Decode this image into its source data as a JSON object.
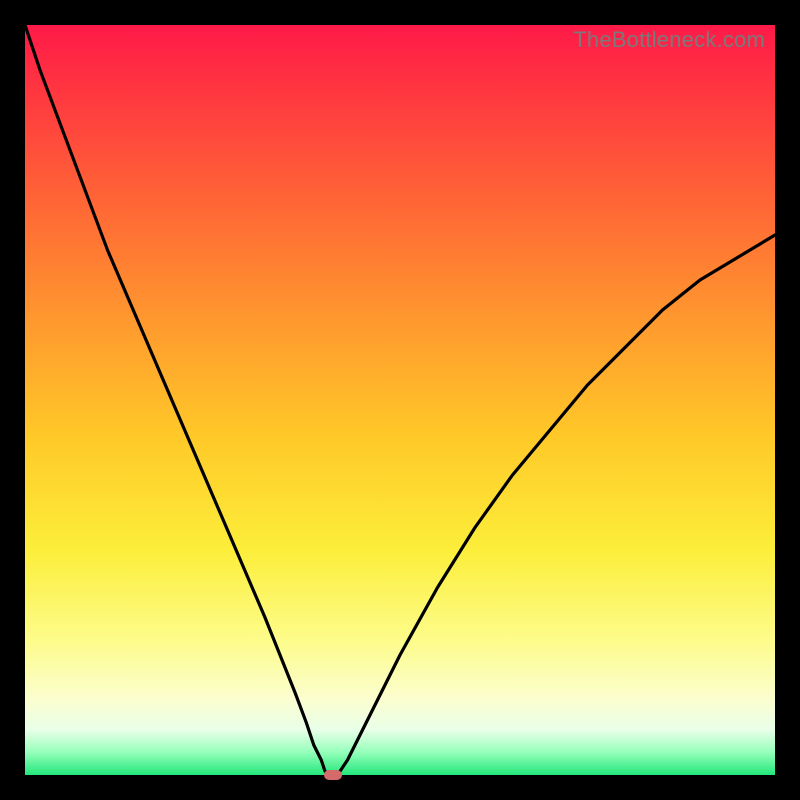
{
  "watermark": "TheBottleneck.com",
  "colors": {
    "background": "#000000",
    "gradient_top": "#ff1a48",
    "gradient_bottom": "#22e77a",
    "curve": "#000000",
    "marker": "#d46a6a"
  },
  "chart_data": {
    "type": "line",
    "title": "",
    "xlabel": "",
    "ylabel": "",
    "xlim": [
      0,
      100
    ],
    "ylim": [
      0,
      100
    ],
    "grid": false,
    "legend": false,
    "marker": {
      "x": 41,
      "y": 0
    },
    "series": [
      {
        "name": "curve",
        "x": [
          0,
          2,
          5,
          8,
          11,
          14,
          17,
          20,
          23,
          26,
          29,
          32,
          34,
          36,
          37.5,
          38.5,
          39.5,
          40,
          41,
          42,
          43,
          45,
          47,
          50,
          55,
          60,
          65,
          70,
          75,
          80,
          85,
          90,
          95,
          100
        ],
        "y": [
          100,
          94,
          86,
          78,
          70,
          63,
          56,
          49,
          42,
          35,
          28,
          21,
          16,
          11,
          7,
          4,
          2,
          0.5,
          0,
          0.5,
          2,
          6,
          10,
          16,
          25,
          33,
          40,
          46,
          52,
          57,
          62,
          66,
          69,
          72
        ]
      }
    ]
  }
}
